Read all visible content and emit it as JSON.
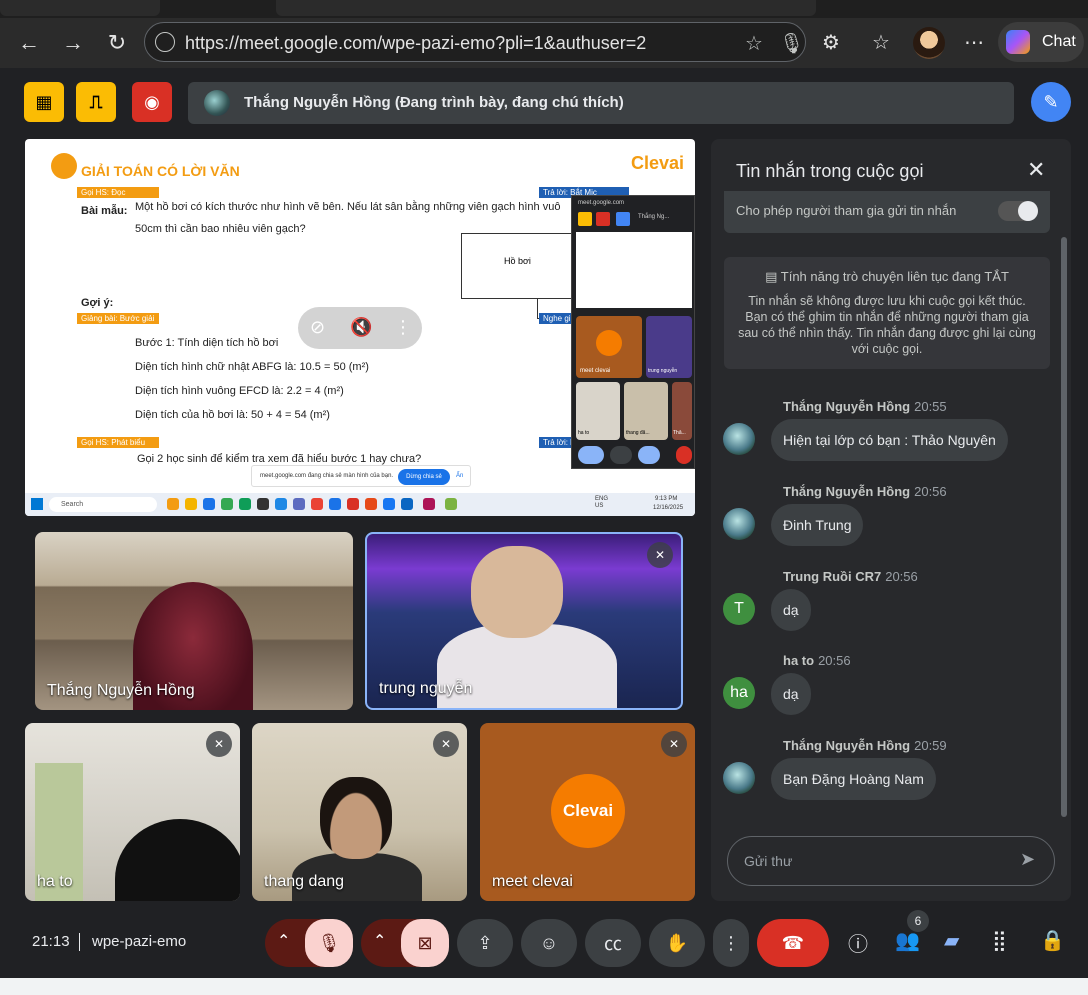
{
  "browser": {
    "url": "https://meet.google.com/wpe-pazi-emo?pli=1&authuser=2",
    "chat_label": "Chat",
    "icons": [
      "back-icon",
      "forward-icon",
      "reload-icon",
      "site-info-icon",
      "star-icon",
      "mic-icon",
      "extensions-icon",
      "favorites-icon",
      "profile-avatar",
      "more-icon"
    ]
  },
  "meet": {
    "presenter_text": "Thắng Nguyễn Hồng (Đang trình bày, đang chú thích)",
    "colors": {
      "yellow": "#fbbc04",
      "red": "#d93025",
      "blue": "#4285f4",
      "hangup": "#d93025"
    }
  },
  "slide": {
    "title": "GIẢI TOÁN CÓ LỜI VĂN",
    "brand": "Clevai",
    "tag_doc": "Gọi HS: Đọc",
    "tag_answer": "Trả lời: Bắt Mic",
    "label_sample": "Bài mẫu:",
    "problem_line1": "Một hồ bơi có kích thước như hình vẽ bên. Nếu lát sân bằng những viên gạch hình vuô",
    "problem_line2": "50cm thì cần bao nhiêu viên gạch?",
    "pool_label": "Hồ bơi",
    "hint_label": "Gợi ý:",
    "tag_explain": "Giảng bài: Bước giải",
    "tag_listen": "Nghe gi",
    "step1": "Bước 1: Tính diện tích hồ bơi",
    "line_abfg": "Diện tích hình chữ nhật ABFG là: 10.5 = 50 (m²)",
    "line_efcd": "Diện tích hình vuông EFCD là: 2.2 = 4 (m²)",
    "line_total": "Diện tích của hồ bơi là: 50 + 4 = 54 (m²)",
    "tag_speak": "Gọi HS: Phát biểu",
    "tag_answer2": "Trả lời: l",
    "question": "Gọi 2 học sinh để kiểm tra xem đã hiểu bước 1 hay chưa?",
    "share_text": "meet.google.com đang chia sẻ màn hình của bạn.",
    "share_stop": "Dừng chia sẻ",
    "share_hide": "Ẩn",
    "taskbar_search": "Search",
    "mini_url": "meet.google.com",
    "mini_presenter": "Thắng Ng...",
    "mini_names": [
      "meet clevai",
      "trung nguyễn",
      "ha to",
      "thang đă...",
      "Thă..."
    ],
    "tray_time": "9:13 PM",
    "tray_date": "12/16/2025",
    "tray_lang": "ENG US"
  },
  "tiles": [
    {
      "name": "Thắng Nguyễn Hồng",
      "muted": false
    },
    {
      "name": "trung nguyễn",
      "muted": true
    },
    {
      "name": "ha to",
      "muted": true
    },
    {
      "name": "thang dang",
      "muted": true
    },
    {
      "name": "meet clevai",
      "muted": true,
      "logo": "Clevai"
    }
  ],
  "chat": {
    "title": "Tin nhắn trong cuộc gọi",
    "allow_label": "Cho phép người tham gia gửi tin nhắn",
    "allow_on": true,
    "info_heading": "Tính năng trò chuyện liên tục đang TẮT",
    "info_body": "Tin nhắn sẽ không được lưu khi cuộc gọi kết thúc. Bạn có thể ghim tin nhắn để những người tham gia sau có thể nhìn thấy. Tin nhắn đang được ghi lại cùng với cuộc gọi.",
    "messages": [
      {
        "sender": "Thắng Nguyễn Hồng",
        "time": "20:55",
        "text": "Hiện tại lớp có bạn : Thảo Nguyên",
        "avatar": ""
      },
      {
        "sender": "Thắng Nguyễn Hồng",
        "time": "20:56",
        "text": "Đinh Trung",
        "avatar": ""
      },
      {
        "sender": "Trung Ruồi CR7",
        "time": "20:56",
        "text": "dạ",
        "avatar": "T",
        "avatar_color": "#3f8f3f"
      },
      {
        "sender": "ha to",
        "time": "20:56",
        "text": "dạ",
        "avatar": "ha",
        "avatar_color": "#3f8f3f"
      },
      {
        "sender": "Thắng Nguyễn Hồng",
        "time": "20:59",
        "text": "Bạn Đặng Hoàng Nam",
        "avatar": ""
      }
    ],
    "input_placeholder": "Gửi thư"
  },
  "bottom": {
    "time": "21:13",
    "meeting_code": "wpe-pazi-emo",
    "participants_count": "6"
  }
}
